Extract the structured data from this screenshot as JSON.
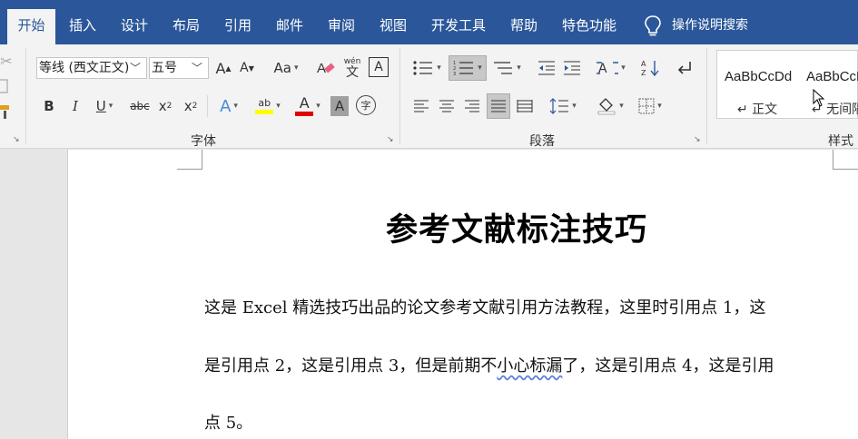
{
  "ribbon_tabs": [
    {
      "label": "开始",
      "active": true
    },
    {
      "label": "插入"
    },
    {
      "label": "设计"
    },
    {
      "label": "布局"
    },
    {
      "label": "引用"
    },
    {
      "label": "邮件"
    },
    {
      "label": "审阅"
    },
    {
      "label": "视图"
    },
    {
      "label": "开发工具"
    },
    {
      "label": "帮助"
    },
    {
      "label": "特色功能"
    }
  ],
  "tell_me": {
    "label": "操作说明搜索",
    "icon": "lightbulb-icon"
  },
  "font_group": {
    "label": "字体",
    "font_name": "等线 (西文正文)",
    "font_size": "五号",
    "grow_label": "A",
    "shrink_label": "A",
    "case_label": "Aa",
    "phonetic_top": "wén",
    "phonetic_bottom": "文",
    "border_char_label": "A",
    "bold": "B",
    "italic": "I",
    "underline": "U",
    "strike": "abc",
    "subscript_base": "x",
    "subscript_sub": "2",
    "superscript_base": "x",
    "superscript_sup": "2",
    "effects_label": "A",
    "highlight_label": "ab",
    "font_color_label": "A",
    "shading_label": "A",
    "enclose_label": "字",
    "highlight_color": "#ffff00",
    "font_color": "#e00000"
  },
  "paragraph_group": {
    "label": "段落"
  },
  "styles_group": {
    "label": "样式",
    "items": [
      {
        "sample": "AaBbCcDd",
        "name": "↵ 正文"
      },
      {
        "sample": "AaBbCcDd",
        "name": "↵ 无间隔"
      }
    ]
  },
  "document": {
    "title": "参考文献标注技巧",
    "lines": [
      "这是 Excel 精选技巧出品的论文参考文献引用方法教程，这里时引用点 1，这",
      "是引用点 2，这是引用点 3，但是前期不",
      "小心标漏",
      "了，这是引用点 4，这是引用",
      "点 5。"
    ]
  },
  "colors": {
    "accent": "#2b579a"
  }
}
